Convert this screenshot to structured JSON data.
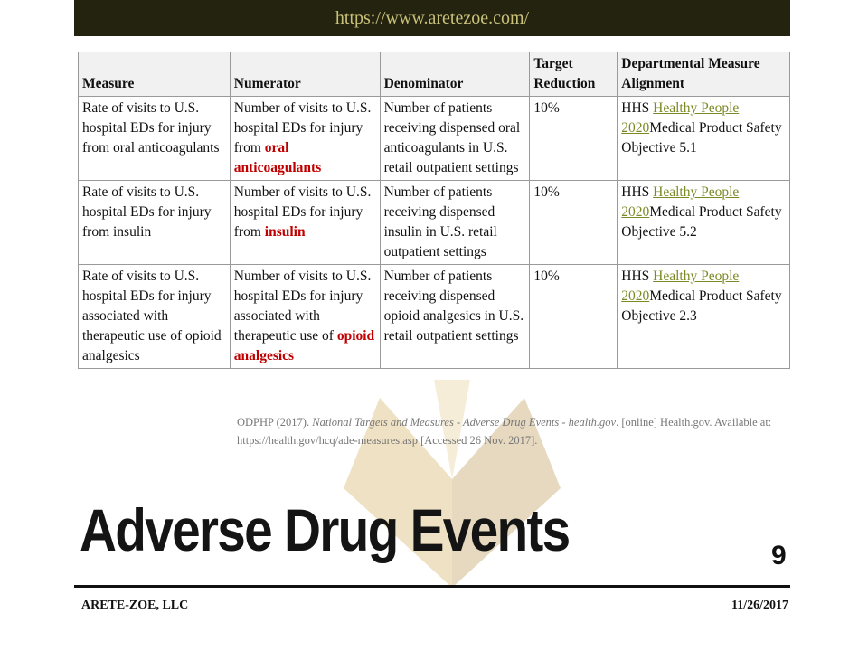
{
  "header": {
    "url": "https://www.aretezoe.com/"
  },
  "table": {
    "columns": [
      "Measure",
      "Numerator",
      "Denominator",
      "Target Reduction",
      "Departmental Measure Alignment"
    ],
    "rows": [
      {
        "measure": "Rate of visits to U.S. hospital EDs for injury from oral anticoagulants",
        "numerator_prefix": "Number of visits to U.S. hospital EDs for injury from ",
        "numerator_drug": "oral anticoagulants",
        "denominator": "Number of patients receiving dispensed oral anticoagulants in U.S. retail outpatient settings",
        "target": "10%",
        "alignment_prefix": "HHS ",
        "alignment_link": "Healthy People 2020",
        "alignment_suffix": "Medical Product Safety Objective 5.1"
      },
      {
        "measure": "Rate of visits to U.S. hospital EDs for injury from insulin",
        "numerator_prefix": "Number of visits to U.S. hospital EDs for injury from ",
        "numerator_drug": "insulin",
        "denominator": "Number of patients receiving dispensed insulin in U.S. retail outpatient settings",
        "target": "10%",
        "alignment_prefix": "HHS ",
        "alignment_link": "Healthy People 2020",
        "alignment_suffix": "Medical Product Safety Objective 5.2"
      },
      {
        "measure": "Rate of visits to U.S. hospital EDs for injury associated with therapeutic use of opioid analgesics",
        "numerator_prefix": "Number of visits to U.S. hospital EDs for injury associated with therapeutic use of ",
        "numerator_drug": "opioid analgesics",
        "denominator": "Number of patients receiving dispensed opioid analgesics in U.S. retail outpatient settings",
        "target": "10%",
        "alignment_prefix": "HHS ",
        "alignment_link": "Healthy People 2020",
        "alignment_suffix": "Medical Product Safety Objective 2.3"
      }
    ]
  },
  "citation": {
    "prefix": "ODPHP (2017). ",
    "title": "National Targets and Measures - Adverse Drug Events - health.gov",
    "suffix": ". [online] Health.gov.  Available  at: https://health.gov/hcq/ade-measures.asp  [Accessed 26 Nov. 2017]."
  },
  "slide": {
    "title": "Adverse Drug Events",
    "page_number": "9"
  },
  "footer": {
    "company": "ARETE-ZOE,  LLC",
    "date": "11/26/2017"
  },
  "colors": {
    "header_bg": "#23230f",
    "url_text": "#c9c17a",
    "highlight": "#c00000",
    "link": "#7c8a26"
  }
}
